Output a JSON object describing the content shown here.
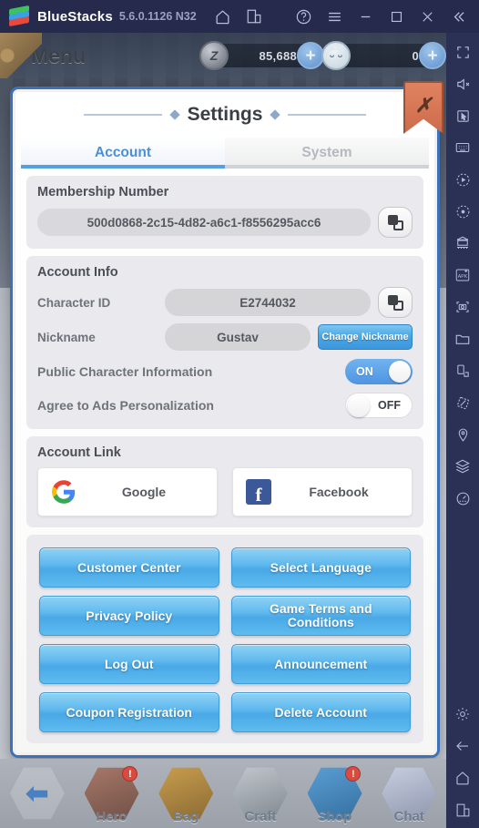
{
  "titlebar": {
    "app_name": "BlueStacks",
    "version": "5.6.0.1126 N32",
    "icons": [
      "home-icon",
      "multi-instance-icon",
      "help-icon",
      "menu-icon",
      "minimize-icon",
      "maximize-icon",
      "close-icon",
      "collapse-icon"
    ]
  },
  "game_header": {
    "menu_label": "Menu",
    "currency": [
      {
        "name": "coin",
        "icon": "z-coin-icon",
        "value": "85,688",
        "plus": "+"
      },
      {
        "name": "cat-token",
        "icon": "cat-icon",
        "value": "0",
        "plus": "+"
      }
    ]
  },
  "dialog": {
    "title": "Settings",
    "close_label": "✗",
    "tabs": [
      {
        "label": "Account",
        "active": true
      },
      {
        "label": "System",
        "active": false
      }
    ],
    "membership": {
      "heading": "Membership Number",
      "value": "500d0868-2c15-4d82-a6c1-f8556295acc6",
      "copy_icon": "copy-icon"
    },
    "account_info": {
      "heading": "Account Info",
      "character_id_label": "Character ID",
      "character_id_value": "E2744032",
      "nickname_label": "Nickname",
      "nickname_value": "Gustav",
      "change_nickname_button": "Change Nickname",
      "toggles": [
        {
          "label": "Public Character Information",
          "state": "ON",
          "on": true
        },
        {
          "label": "Agree to Ads Personalization",
          "state": "OFF",
          "on": false
        }
      ]
    },
    "account_link": {
      "heading": "Account Link",
      "providers": [
        {
          "label": "Google",
          "icon": "google-icon"
        },
        {
          "label": "Facebook",
          "icon": "facebook-icon"
        }
      ]
    },
    "buttons": [
      "Customer Center",
      "Select Language",
      "Privacy Policy",
      "Game Terms and Conditions",
      "Log Out",
      "Announcement",
      "Coupon Registration",
      "Delete Account"
    ]
  },
  "bottom_nav": [
    {
      "label": "",
      "icon": "back-arrow-icon",
      "badge": ""
    },
    {
      "label": "Hero",
      "icon": "hero-icon",
      "badge": "!"
    },
    {
      "label": "Bag",
      "icon": "bag-icon",
      "badge": ""
    },
    {
      "label": "Craft",
      "icon": "craft-icon",
      "badge": ""
    },
    {
      "label": "Shop",
      "icon": "shop-icon",
      "badge": "!"
    },
    {
      "label": "Chat",
      "icon": "chat-icon",
      "badge": ""
    }
  ],
  "sidebar": {
    "top_icons": [
      "fullscreen-icon",
      "mute-icon",
      "cursor-icon",
      "keyboard-icon",
      "macro-play-icon",
      "macro-record-icon",
      "multi-instance-manager-icon",
      "install-apk-icon",
      "screenshot-icon",
      "folder-icon",
      "rotate-icon",
      "tilt-icon",
      "location-icon",
      "layers-icon",
      "meter-icon"
    ],
    "bottom_icons": [
      "gear-icon",
      "back-icon",
      "home-icon",
      "recents-icon"
    ]
  },
  "colors": {
    "accent_blue": "#54a0e4",
    "tab_inactive": "#b4b9c0",
    "button_blue": "#49a8e6",
    "close_orange": "#cd6c4c",
    "titlebar_bg": "#262b4d",
    "sidebar_bg": "#2b3055",
    "badge_red": "#d94a3f"
  }
}
